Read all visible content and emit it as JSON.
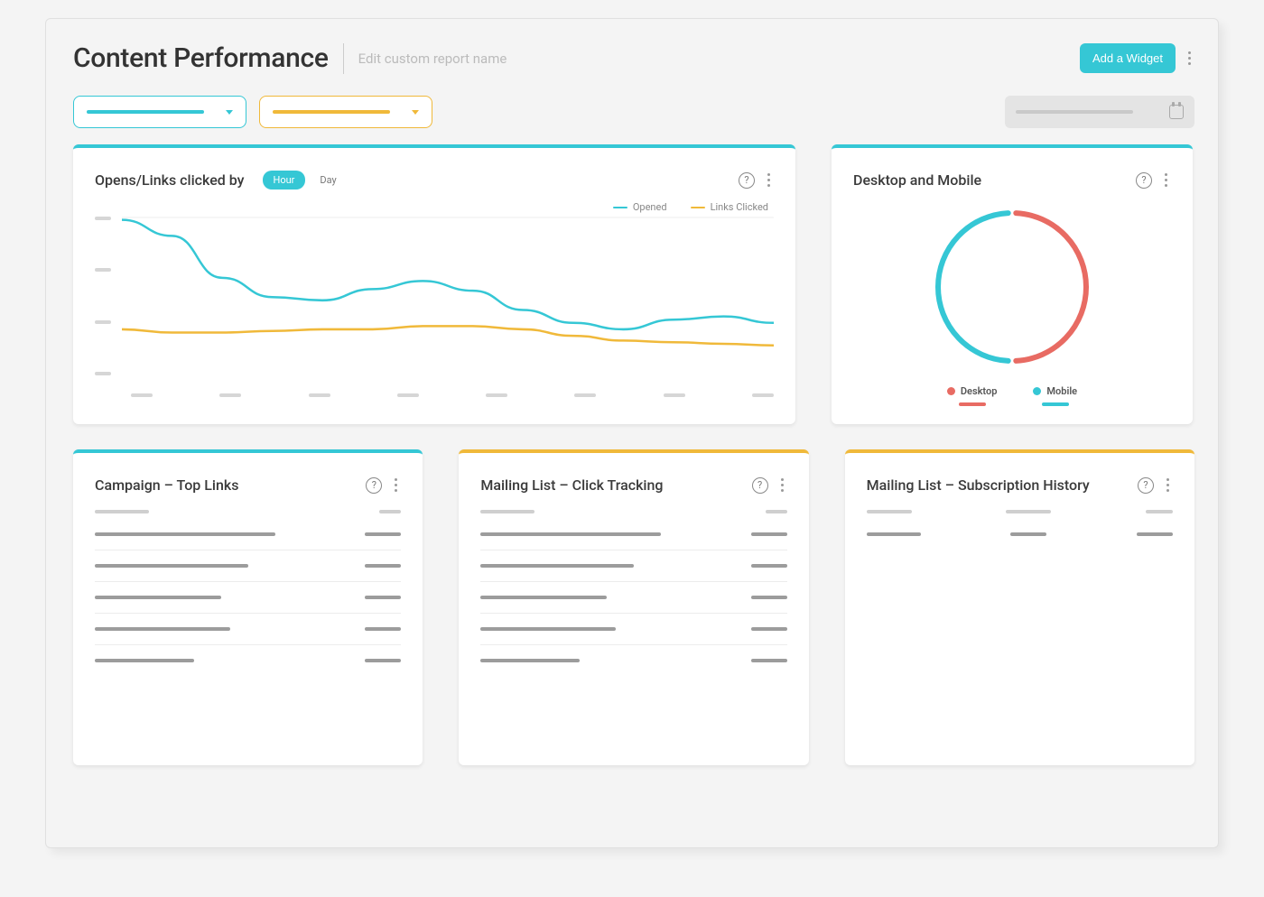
{
  "header": {
    "title": "Content Performance",
    "subtitle": "Edit custom report name",
    "add_widget_label": "Add a Widget"
  },
  "colors": {
    "teal": "#35c7d5",
    "amber": "#f0b93a",
    "coral": "#e86b63"
  },
  "cards": {
    "opens_links": {
      "title": "Opens/Links clicked by",
      "toggle_hour": "Hour",
      "toggle_day": "Day",
      "legend_opened": "Opened",
      "legend_links": "Links Clicked"
    },
    "desktop_mobile": {
      "title": "Desktop and Mobile",
      "legend_desktop": "Desktop",
      "legend_mobile": "Mobile"
    },
    "top_links": {
      "title": "Campaign – Top Links"
    },
    "click_tracking": {
      "title": "Mailing List – Click Tracking"
    },
    "sub_history": {
      "title": "Mailing List – Subscription History"
    }
  },
  "chart_data": [
    {
      "id": "opens_links_by_hour",
      "type": "line",
      "title": "Opens/Links clicked by Hour",
      "x": [
        0,
        1,
        2,
        3,
        4,
        5,
        6,
        7,
        8,
        9,
        10,
        11,
        12,
        13
      ],
      "x_tick_count": 8,
      "y_tick_count": 4,
      "ylim": [
        0,
        100
      ],
      "series": [
        {
          "name": "Opened",
          "color": "#35c7d5",
          "values": [
            98,
            88,
            62,
            50,
            48,
            55,
            60,
            54,
            42,
            34,
            30,
            36,
            38,
            34
          ]
        },
        {
          "name": "Links Clicked",
          "color": "#f0b93a",
          "values": [
            30,
            28,
            28,
            29,
            30,
            30,
            32,
            32,
            30,
            26,
            23,
            22,
            21,
            20
          ]
        }
      ]
    },
    {
      "id": "desktop_mobile_split",
      "type": "pie",
      "title": "Desktop and Mobile",
      "series": [
        {
          "name": "Desktop",
          "color": "#e86b63",
          "value": 50
        },
        {
          "name": "Mobile",
          "color": "#35c7d5",
          "value": 50
        }
      ]
    }
  ]
}
